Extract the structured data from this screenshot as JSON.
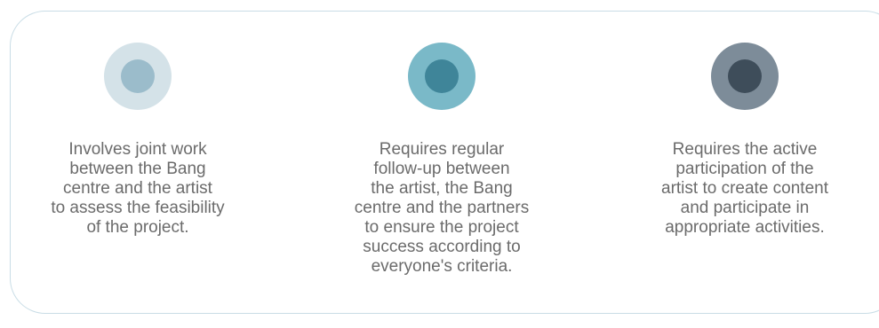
{
  "items": [
    {
      "icon": "circle-icon",
      "outer_color": "#d4e2e8",
      "inner_color": "#9bbccb",
      "text": "Involves joint work\nbetween the Bang\ncentre and the artist\nto assess the feasibility\nof the project."
    },
    {
      "icon": "circle-icon",
      "outer_color": "#7ab9c8",
      "inner_color": "#3f8599",
      "text": "Requires regular\nfollow-up between\nthe artist, the Bang\ncentre and the partners\nto ensure the project\nsuccess according to\neveryone's criteria."
    },
    {
      "icon": "circle-icon",
      "outer_color": "#7d8c99",
      "inner_color": "#3e4d5a",
      "text": "Requires the active\nparticipation of the\nartist to create content\nand participate in\nappropriate activities."
    }
  ]
}
